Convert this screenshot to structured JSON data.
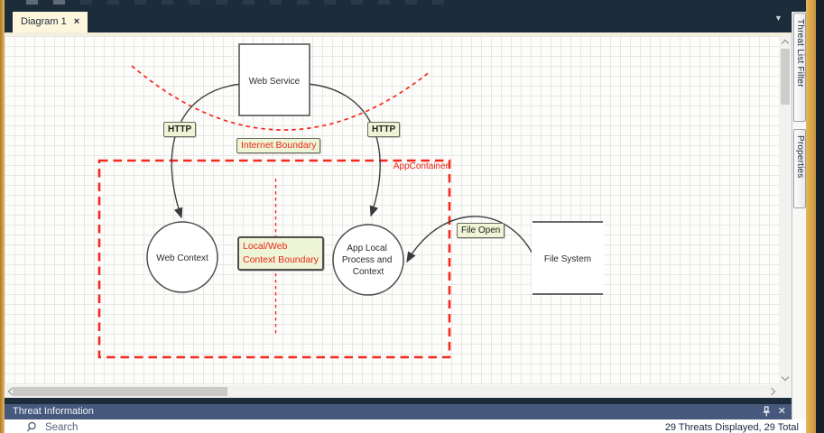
{
  "tab_bar": {
    "active_tab": "Diagram 1",
    "close_glyph": "×",
    "overflow_glyph": "▼"
  },
  "side_tabs": {
    "threat_list_filter": "Threat List Filter",
    "properties": "Properties"
  },
  "diagram": {
    "nodes": {
      "web_service": {
        "label": "Web Service",
        "shape": "rectangle"
      },
      "web_context": {
        "label": "Web Context",
        "shape": "circle"
      },
      "app_local": {
        "shape": "circle",
        "lines": [
          "App Local",
          "Process and",
          "Context"
        ]
      },
      "file_system": {
        "label": "File System",
        "shape": "data-store"
      }
    },
    "flows": {
      "http_left": "HTTP",
      "http_right": "HTTP",
      "file_open": "File Open"
    },
    "boundaries": {
      "internet": "Internet Boundary",
      "app_container": "AppContainer",
      "local_web": [
        "Local/Web",
        "Context Boundary"
      ]
    },
    "colors": {
      "boundary_red": "#ec2517",
      "label_bg": "#eef4d6",
      "flow_stroke": "#3f3f3f"
    }
  },
  "threat_panel": {
    "title": "Threat Information",
    "search_label": "Search",
    "status": "29 Threats Displayed, 29 Total"
  }
}
